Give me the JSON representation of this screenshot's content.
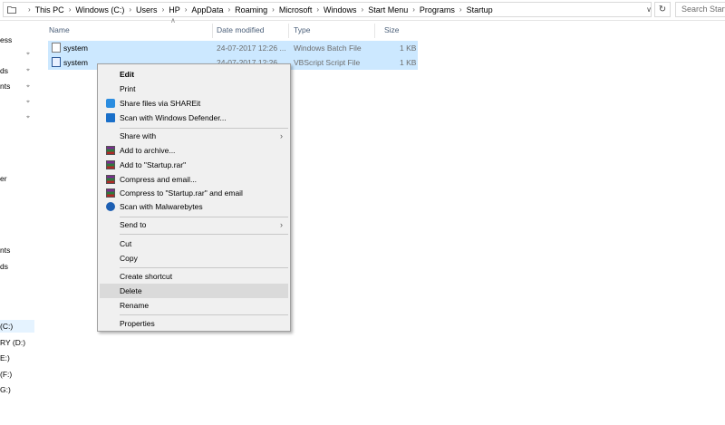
{
  "address_bar": {
    "crumbs": [
      "This PC",
      "Windows (C:)",
      "Users",
      "HP",
      "AppData",
      "Roaming",
      "Microsoft",
      "Windows",
      "Start Menu",
      "Programs",
      "Startup"
    ],
    "search_placeholder": "Search Startup"
  },
  "navpane": {
    "items": [
      "ess",
      "ds",
      "nts",
      "er",
      "nts",
      "ds",
      "(C:)",
      "RY (D:)",
      "E:)",
      "(F:)",
      "G:)"
    ],
    "selected_item": "(C:)"
  },
  "file_list": {
    "columns": [
      "Name",
      "Date modified",
      "Type",
      "Size"
    ],
    "rows": [
      {
        "name": "system",
        "date": "24-07-2017 12:26 ...",
        "type": "Windows Batch File",
        "size": "1 KB",
        "icon": "batch-file-icon"
      },
      {
        "name": "system",
        "date": "24-07-2017 12:26 ...",
        "type": "VBScript Script File",
        "size": "1 KB",
        "icon": "vbscript-file-icon"
      }
    ]
  },
  "context_menu": {
    "edit": "Edit",
    "print": "Print",
    "share_shareit": "Share files via SHAREit",
    "scan_defender": "Scan with Windows Defender...",
    "share_with": "Share with",
    "add_archive": "Add to archive...",
    "add_startup_rar": "Add to \"Startup.rar\"",
    "compress_email": "Compress and email...",
    "compress_startup_email": "Compress to \"Startup.rar\" and email",
    "scan_malwarebytes": "Scan with Malwarebytes",
    "send_to": "Send to",
    "cut": "Cut",
    "copy": "Copy",
    "create_shortcut": "Create shortcut",
    "delete": "Delete",
    "rename": "Rename",
    "properties": "Properties",
    "hovered_item": "Delete"
  },
  "colors": {
    "selection": "#cce8ff",
    "menu_bg": "#f0f0f0",
    "menu_hover": "#dadada",
    "header_text": "#4c607a"
  }
}
